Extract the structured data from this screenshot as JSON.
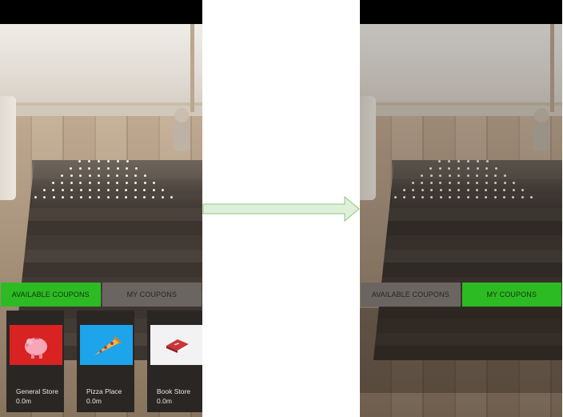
{
  "left_screen": {
    "tabs": [
      {
        "label": "AVAILABLE COUPONS",
        "active": true
      },
      {
        "label": "MY COUPONS",
        "active": false
      }
    ],
    "coupons": [
      {
        "name": "General Store",
        "distance": "0.0m",
        "icon": "piggy-bank-icon",
        "bg": "#d92222"
      },
      {
        "name": "Pizza Place",
        "distance": "0.0m",
        "icon": "pizza-slice-icon",
        "bg": "#1ea4ea"
      },
      {
        "name": "Book Store",
        "distance": "0.0m",
        "icon": "book-icon",
        "bg": "#f2f2f2"
      }
    ]
  },
  "right_screen": {
    "tabs": [
      {
        "label": "AVAILABLE COUPONS",
        "active": false
      },
      {
        "label": "MY COUPONS",
        "active": true
      }
    ]
  },
  "colors": {
    "active_tab": "#2dbb23",
    "inactive_tab": "#6b6562",
    "card_bg": "#2a2624",
    "arrow_fill": "#dff0da",
    "arrow_stroke": "#8cc47e"
  }
}
